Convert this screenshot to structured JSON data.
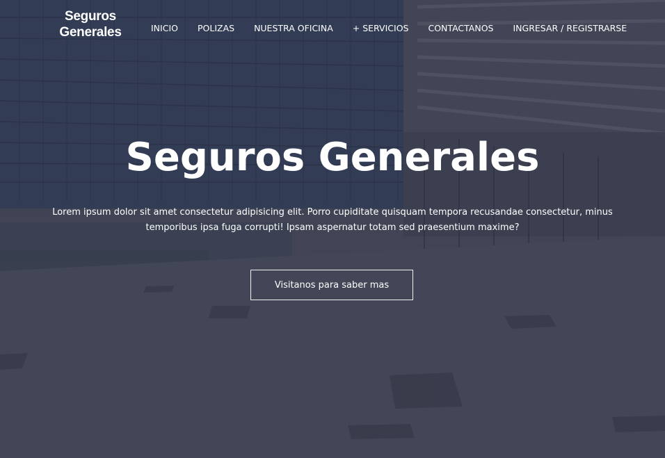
{
  "brand": {
    "line1": "Seguros",
    "line2": "Generales"
  },
  "nav": {
    "items": [
      {
        "label": "INICIO"
      },
      {
        "label": "POLIZAS"
      },
      {
        "label": "NUESTRA OFICINA"
      },
      {
        "label": "+ SERVICIOS"
      },
      {
        "label": "CONTACTANOS"
      },
      {
        "label": "INGRESAR / REGISTRARSE"
      }
    ]
  },
  "hero": {
    "title": "Seguros Generales",
    "text": "Lorem ipsum dolor sit amet consectetur adipisicing elit. Porro cupiditate quisquam tempora recusandae consectetur, minus temporibus ipsa fuga corrupti! Ipsam aspernatur totam sed praesentium maxime?",
    "button_label": "Visitanos para saber mas"
  },
  "colors": {
    "text": "#ffffff",
    "overlay": "#3a3d4c"
  }
}
